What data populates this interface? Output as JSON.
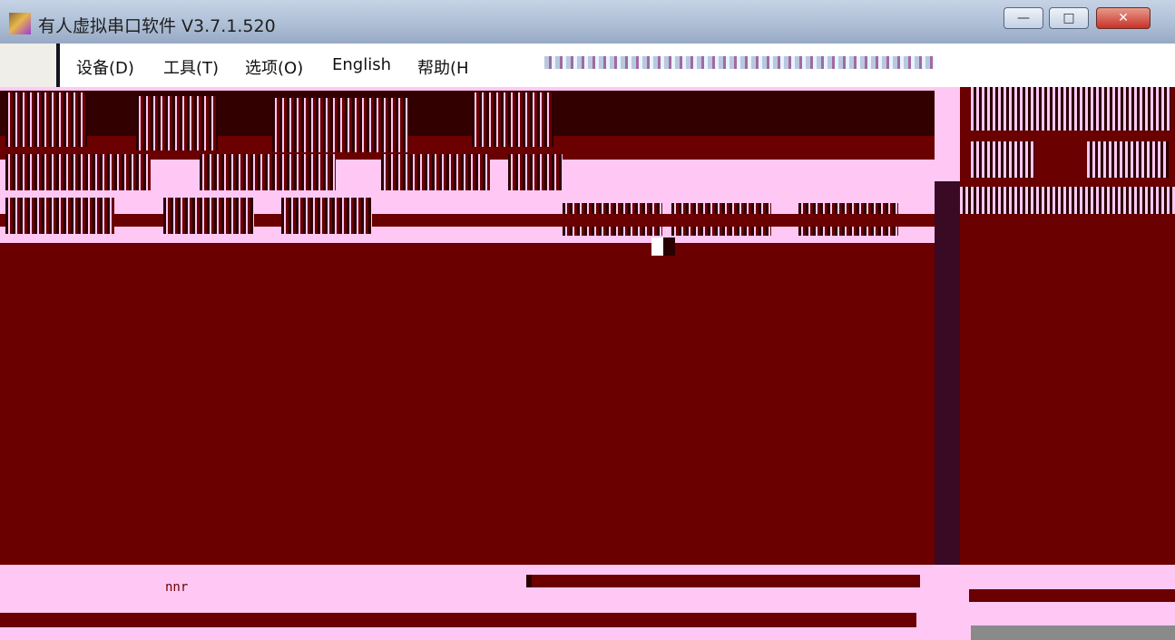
{
  "window": {
    "title": "有人虚拟串口软件 V3.7.1.520",
    "minimize_glyph": "—",
    "maximize_glyph": "□",
    "close_glyph": "✕"
  },
  "menu": {
    "items": [
      {
        "label": "设备(D)"
      },
      {
        "label": "工具(T)"
      },
      {
        "label": "选项(O)"
      },
      {
        "label": "English"
      },
      {
        "label": "帮助(H"
      }
    ]
  },
  "status": {
    "fragment": "nnr"
  },
  "colors": {
    "main_bg": "#6b0000",
    "panel_bg": "#ffc8f4",
    "dark": "#2a0000",
    "splitter": "#3a0a24"
  },
  "icons": {
    "app": "app-icon"
  }
}
